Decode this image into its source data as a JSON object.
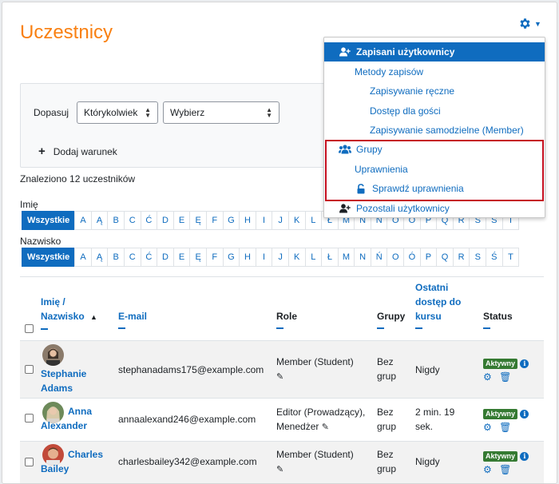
{
  "page": {
    "title": "Uczestnicy"
  },
  "filter": {
    "match_label": "Dopasuj",
    "match_value": "Którykolwiek",
    "choose_value": "Wybierz",
    "add_condition": "Dodaj warunek"
  },
  "found": "Znaleziono 12 uczestników",
  "initials": {
    "first_label": "Imię",
    "last_label": "Nazwisko",
    "all_label": "Wszystkie",
    "first_letters": [
      "A",
      "Ą",
      "B",
      "C",
      "Ć",
      "D",
      "E",
      "Ę",
      "F",
      "G",
      "H",
      "I",
      "J",
      "K",
      "L",
      "Ł",
      "M",
      "N",
      "Ń",
      "O",
      "Ó",
      "P",
      "Q",
      "R",
      "S",
      "Ś",
      "T"
    ],
    "last_letters": [
      "A",
      "Ą",
      "B",
      "C",
      "Ć",
      "D",
      "E",
      "Ę",
      "F",
      "G",
      "H",
      "I",
      "J",
      "K",
      "L",
      "Ł",
      "M",
      "N",
      "Ń",
      "O",
      "Ó",
      "P",
      "Q",
      "R",
      "S",
      "Ś",
      "T"
    ]
  },
  "table": {
    "headers": {
      "name_line1": "Imię /",
      "name_line2": "Nazwisko",
      "email": "E-mail",
      "roles": "Role",
      "groups": "Grupy",
      "access_line1": "Ostatni",
      "access_line2": "dostęp do",
      "access_line3": "kursu",
      "status": "Status"
    },
    "rows": [
      {
        "first": "Stephanie",
        "last": "Adams",
        "email": "stephanadams175@example.com",
        "role1": "Member (Student)",
        "role2": "",
        "group1": "Bez",
        "group2": "grup",
        "access1": "Nigdy",
        "access2": "",
        "status": "Aktywny"
      },
      {
        "first": "Anna",
        "last": "Alexander",
        "email": "annaalexand246@example.com",
        "role1": "Editor (Prowadzący),",
        "role2": "Menedżer",
        "group1": "Bez",
        "group2": "grup",
        "access1": "2 min. 19",
        "access2": "sek.",
        "status": "Aktywny"
      },
      {
        "first": "Charles",
        "last": "Bailey",
        "email": "charlesbailey342@example.com",
        "role1": "Member (Student)",
        "role2": "",
        "group1": "Bez",
        "group2": "grup",
        "access1": "Nigdy",
        "access2": "",
        "status": "Aktywny"
      }
    ]
  },
  "menu": {
    "enrolled": "Zapisani użytkownicy",
    "methods": "Metody zapisów",
    "manual": "Zapisywanie ręczne",
    "guest": "Dostęp dla gości",
    "self": "Zapisywanie samodzielne (Member)",
    "groups": "Grupy",
    "permissions": "Uprawnienia",
    "check_permissions": "Sprawdź uprawnienia",
    "other_users": "Pozostali użytkownicy"
  },
  "colors": {
    "accent": "#0f6cbf",
    "title": "#f98012",
    "active_badge": "#357a32",
    "highlight": "#c50f1f"
  }
}
